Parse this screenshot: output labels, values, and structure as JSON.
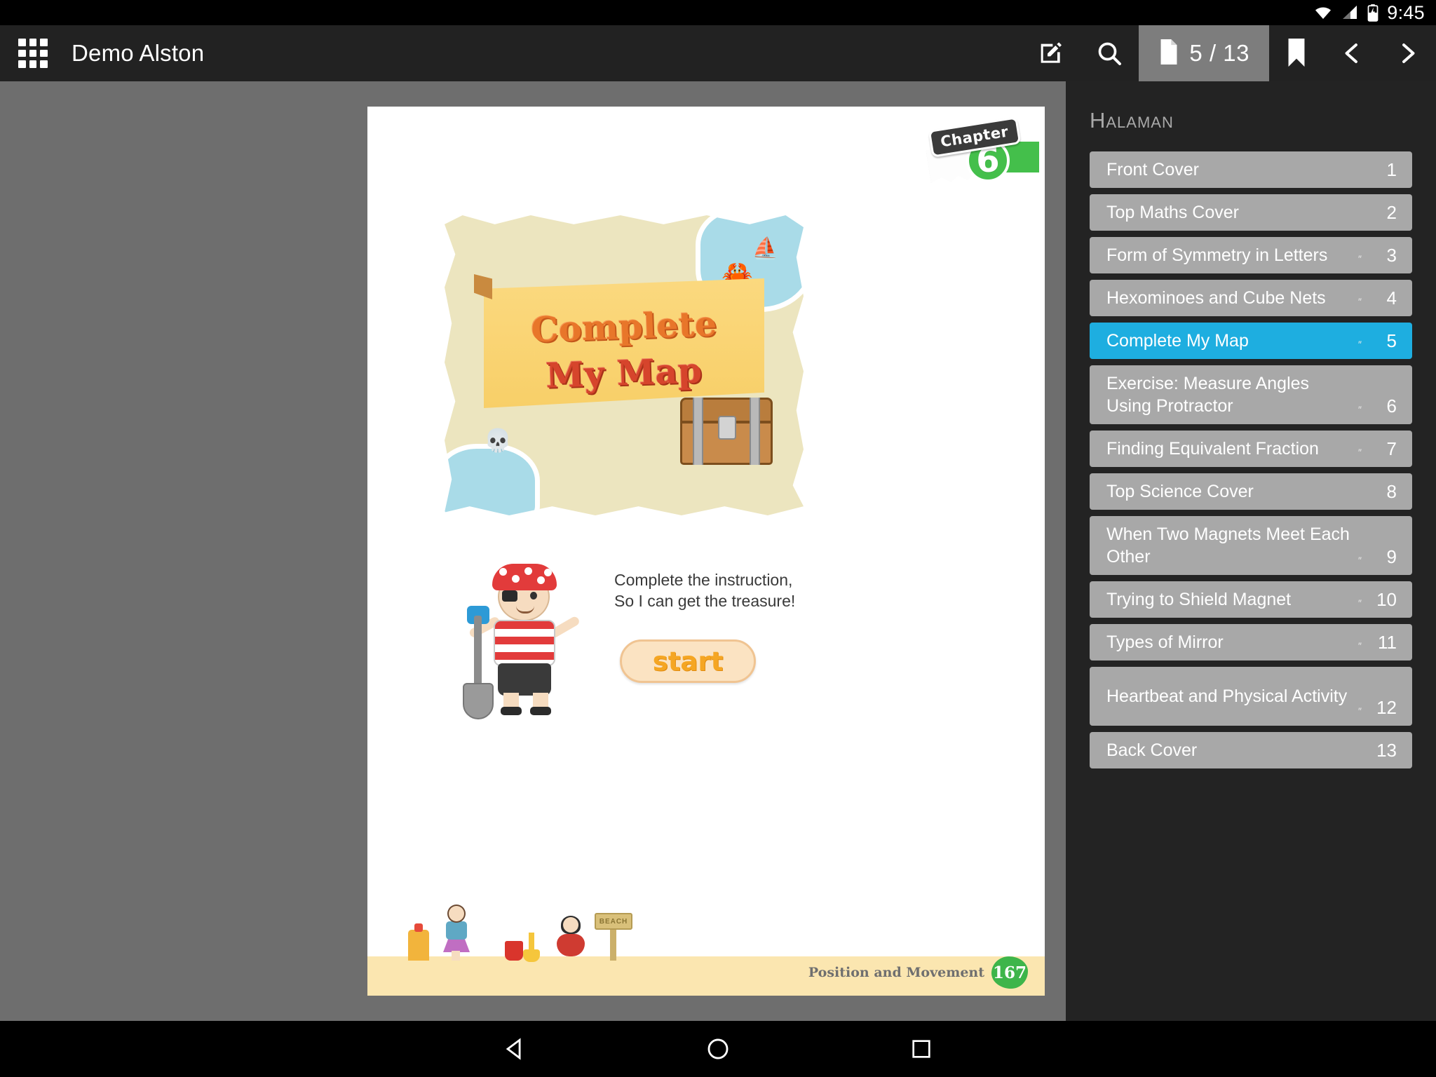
{
  "statusbar": {
    "time": "9:45",
    "wifi_icon": "wifi-icon",
    "signal_icon": "signal-icon",
    "battery_icon": "battery-charging-icon"
  },
  "appbar": {
    "menu_icon": "apps-grid-icon",
    "title": "Demo Alston",
    "edit_icon": "edit-pencil-icon",
    "search_icon": "search-icon",
    "page_doc_icon": "document-icon",
    "page_indicator": "5 / 13",
    "bookmark_icon": "bookmark-icon",
    "prev_icon": "chevron-left-icon",
    "next_icon": "chevron-right-icon"
  },
  "page": {
    "chapter_word": "Chapter",
    "chapter_number": "6",
    "banner_line1": "Complete",
    "banner_line2": "My Map",
    "ship_icon": "sailing-ship-icon",
    "crab_icon": "crab-icon",
    "skull_icon": "skull-and-crossbones-icon",
    "chest_icon": "treasure-chest-icon",
    "instruction_line1": "Complete the instruction,",
    "instruction_line2": "So I can get the treasure!",
    "start_button": "start",
    "beach_sign": "BEACH",
    "footer_title": "Position and Movement",
    "footer_page": "167"
  },
  "sidebar": {
    "title": "Halaman",
    "items": [
      {
        "label": "Front Cover",
        "mark": "",
        "number": "1",
        "active": false
      },
      {
        "label": "Top Maths Cover",
        "mark": "",
        "number": "2",
        "active": false
      },
      {
        "label": "Form of Symmetry in Letters",
        "mark": "″",
        "number": "3",
        "active": false
      },
      {
        "label": "Hexominoes and Cube Nets",
        "mark": "″",
        "number": "4",
        "active": false
      },
      {
        "label": "Complete My Map",
        "mark": "″",
        "number": "5",
        "active": true
      },
      {
        "label": "Exercise: Measure Angles Using Protractor",
        "mark": "″",
        "number": "6",
        "active": false
      },
      {
        "label": "Finding Equivalent Fraction",
        "mark": "″",
        "number": "7",
        "active": false
      },
      {
        "label": "Top Science Cover",
        "mark": "",
        "number": "8",
        "active": false
      },
      {
        "label": "When Two Magnets Meet Each Other",
        "mark": "″",
        "number": "9",
        "active": false
      },
      {
        "label": "Trying to Shield Magnet",
        "mark": "″",
        "number": "10",
        "active": false
      },
      {
        "label": "Types of Mirror",
        "mark": "″",
        "number": "11",
        "active": false
      },
      {
        "label": "Heartbeat and Physical Activity",
        "mark": "″",
        "number": "12",
        "active": false
      },
      {
        "label": "Back Cover",
        "mark": "",
        "number": "13",
        "active": false
      }
    ]
  },
  "navbar": {
    "back_icon": "triangle-back-icon",
    "home_icon": "circle-home-icon",
    "recents_icon": "square-recents-icon"
  },
  "colors": {
    "accent": "#1eaee0",
    "toc_item": "#a8a8a8",
    "sidebar_bg": "#232323",
    "appbar_bg": "#222222",
    "chapter_green": "#44bf4b"
  }
}
